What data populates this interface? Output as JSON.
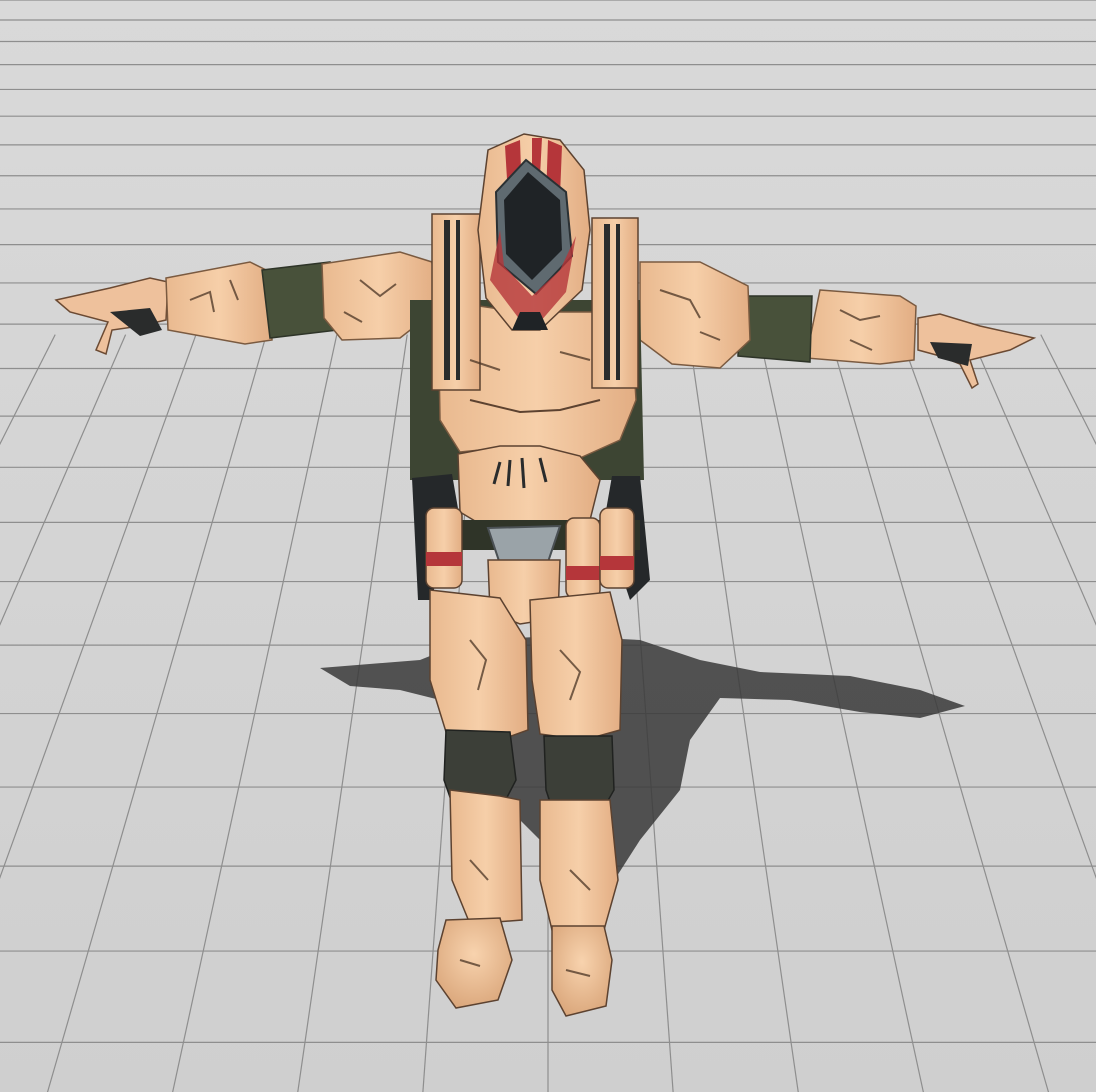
{
  "scene": {
    "kind": "3d-model-viewport",
    "subject": "armored-soldier-t-pose",
    "background_color": "#d3d3d3",
    "grid_line_color": "#8e8e8e",
    "shadow_color": "#3a3a3a"
  },
  "model": {
    "armor_color": "#f0c49c",
    "armor_shade_color": "#d9a27a",
    "undersuit_color": "#48513a",
    "visor_color": "#1f2326",
    "visor_frame_color": "#5f6a70",
    "accent_stripe_color": "#b5363a",
    "metal_color": "#9aa3a8",
    "knee_pad_color": "#3c3f38"
  }
}
